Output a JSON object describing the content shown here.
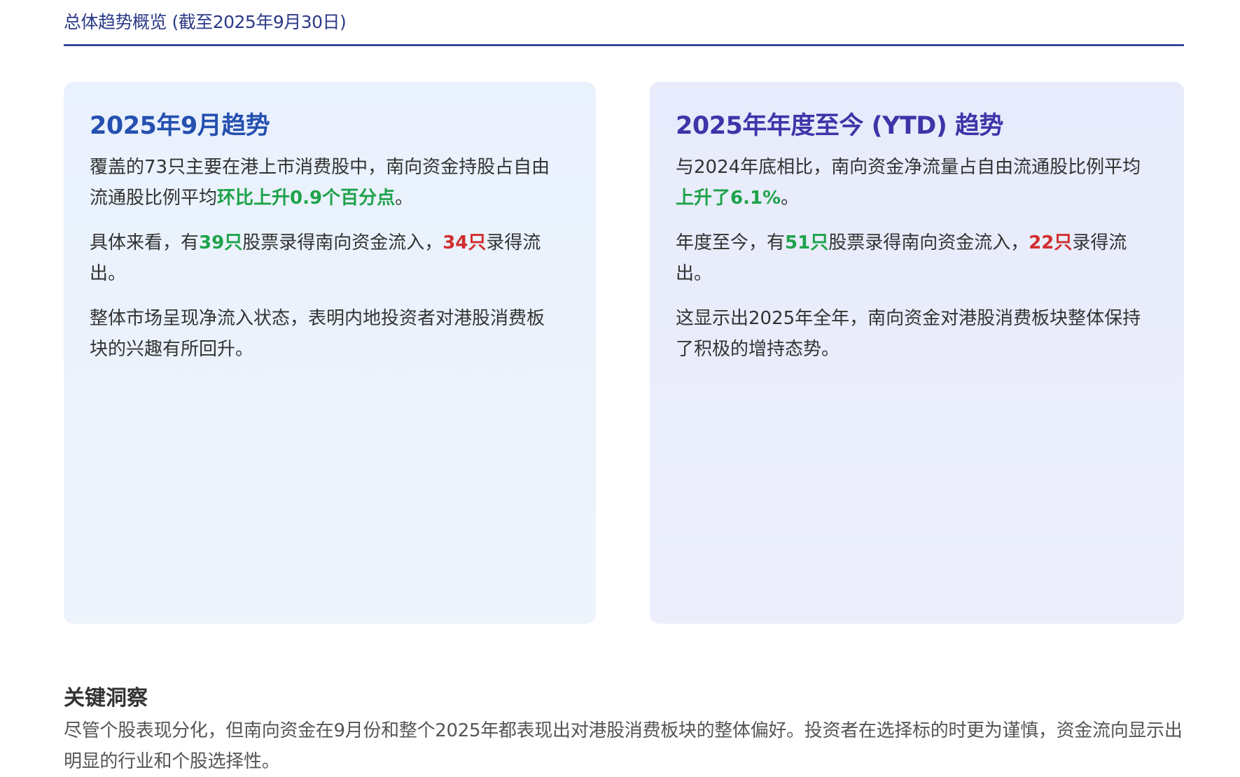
{
  "header": {
    "title": "总体趋势概览 (截至2025年9月30日)"
  },
  "cards": {
    "september": {
      "title": "2025年9月趋势",
      "p1": {
        "pre": "覆盖的73只主要在港上市消费股中，南向资金持股占自由流通股比例平均",
        "highlight": "环比上升0.9个百分点",
        "post": "。"
      },
      "p2": {
        "pre": "具体来看，有",
        "inflow_count": "39只",
        "mid": "股票录得南向资金流入，",
        "outflow_count": "34只",
        "post": "录得流出。"
      },
      "p3": "整体市场呈现净流入状态，表明内地投资者对港股消费板块的兴趣有所回升。"
    },
    "ytd": {
      "title": "2025年年度至今 (YTD) 趋势",
      "p1": {
        "pre": "与2024年底相比，南向资金净流量占自由流通股比例平均",
        "highlight": "上升了6.1%",
        "post": "。"
      },
      "p2": {
        "pre": "年度至今，有",
        "inflow_count": "51只",
        "mid": "股票录得南向资金流入，",
        "outflow_count": "22只",
        "post": "录得流出。"
      },
      "p3": "这显示出2025年全年，南向资金对港股消费板块整体保持了积极的增持态势。"
    }
  },
  "insight": {
    "title": "关键洞察",
    "body": "尽管个股表现分化，但南向资金在9月份和整个2025年都表现出对港股消费板块的整体偏好。投资者在选择标的时更为谨慎，资金流向显示出明显的行业和个股选择性。"
  },
  "colors": {
    "header": "#2b3a87",
    "rule": "#3c46a0",
    "card_left_title": "#2550b0",
    "card_right_title": "#3d35a8",
    "positive": "#1ea34a",
    "negative": "#d12e2e"
  }
}
